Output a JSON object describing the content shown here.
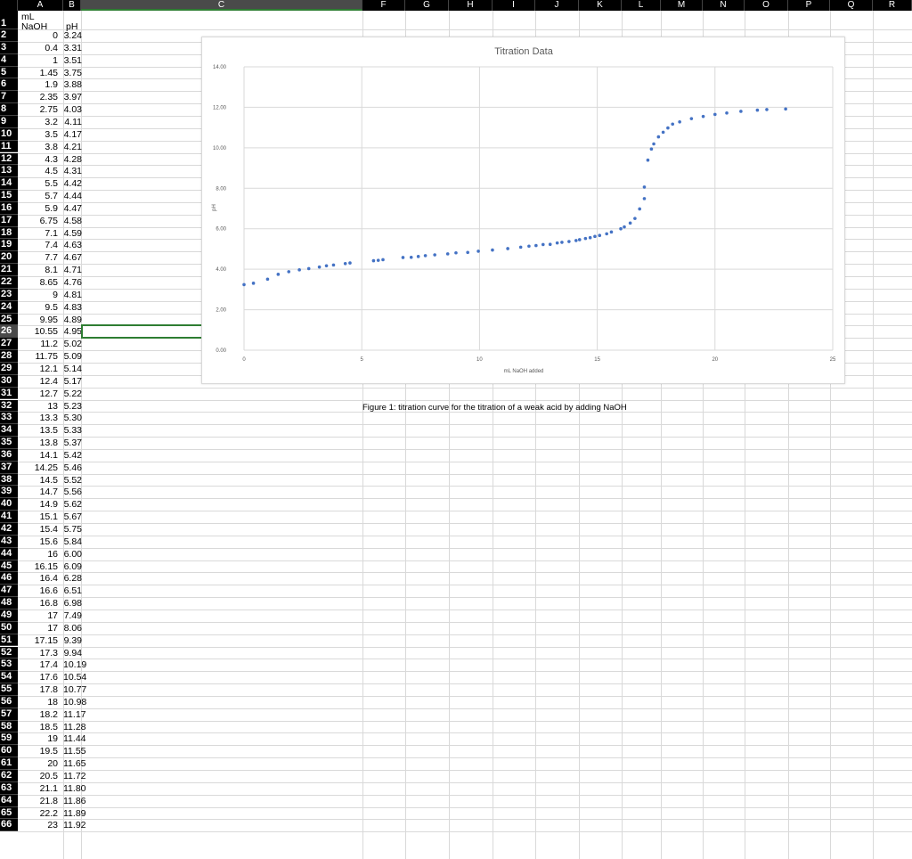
{
  "columns": [
    "A",
    "B",
    "C",
    "F",
    "G",
    "H",
    "I",
    "J",
    "K",
    "L",
    "M",
    "N",
    "O",
    "P",
    "Q",
    "R"
  ],
  "selected_column": "C",
  "header_row": {
    "a1": "mL",
    "a2": "NaOH",
    "b": "pH"
  },
  "rows": [
    [
      "0",
      "3.24"
    ],
    [
      "0.4",
      "3.31"
    ],
    [
      "1",
      "3.51"
    ],
    [
      "1.45",
      "3.75"
    ],
    [
      "1.9",
      "3.88"
    ],
    [
      "2.35",
      "3.97"
    ],
    [
      "2.75",
      "4.03"
    ],
    [
      "3.2",
      "4.11"
    ],
    [
      "3.5",
      "4.17"
    ],
    [
      "3.8",
      "4.21"
    ],
    [
      "4.3",
      "4.28"
    ],
    [
      "4.5",
      "4.31"
    ],
    [
      "5.5",
      "4.42"
    ],
    [
      "5.7",
      "4.44"
    ],
    [
      "5.9",
      "4.47"
    ],
    [
      "6.75",
      "4.58"
    ],
    [
      "7.1",
      "4.59"
    ],
    [
      "7.4",
      "4.63"
    ],
    [
      "7.7",
      "4.67"
    ],
    [
      "8.1",
      "4.71"
    ],
    [
      "8.65",
      "4.76"
    ],
    [
      "9",
      "4.81"
    ],
    [
      "9.5",
      "4.83"
    ],
    [
      "9.95",
      "4.89"
    ],
    [
      "10.55",
      "4.95"
    ],
    [
      "11.2",
      "5.02"
    ],
    [
      "11.75",
      "5.09"
    ],
    [
      "12.1",
      "5.14"
    ],
    [
      "12.4",
      "5.17"
    ],
    [
      "12.7",
      "5.22"
    ],
    [
      "13",
      "5.23"
    ],
    [
      "13.3",
      "5.30"
    ],
    [
      "13.5",
      "5.33"
    ],
    [
      "13.8",
      "5.37"
    ],
    [
      "14.1",
      "5.42"
    ],
    [
      "14.25",
      "5.46"
    ],
    [
      "14.5",
      "5.52"
    ],
    [
      "14.7",
      "5.56"
    ],
    [
      "14.9",
      "5.62"
    ],
    [
      "15.1",
      "5.67"
    ],
    [
      "15.4",
      "5.75"
    ],
    [
      "15.6",
      "5.84"
    ],
    [
      "16",
      "6.00"
    ],
    [
      "16.15",
      "6.09"
    ],
    [
      "16.4",
      "6.28"
    ],
    [
      "16.6",
      "6.51"
    ],
    [
      "16.8",
      "6.98"
    ],
    [
      "17",
      "7.49"
    ],
    [
      "17",
      "8.06"
    ],
    [
      "17.15",
      "9.39"
    ],
    [
      "17.3",
      "9.94"
    ],
    [
      "17.4",
      "10.19"
    ],
    [
      "17.6",
      "10.54"
    ],
    [
      "17.8",
      "10.77"
    ],
    [
      "18",
      "10.98"
    ],
    [
      "18.2",
      "11.17"
    ],
    [
      "18.5",
      "11.28"
    ],
    [
      "19",
      "11.44"
    ],
    [
      "19.5",
      "11.55"
    ],
    [
      "20",
      "11.65"
    ],
    [
      "20.5",
      "11.72"
    ],
    [
      "21.1",
      "11.80"
    ],
    [
      "21.8",
      "11.86"
    ],
    [
      "22.2",
      "11.89"
    ],
    [
      "23",
      "11.92"
    ]
  ],
  "active_row": "26",
  "chart_data": {
    "type": "scatter",
    "title": "Titration Data",
    "xlabel": "mL NaOH added",
    "ylabel": "pH",
    "xlim": [
      0,
      25
    ],
    "ylim": [
      0,
      14
    ],
    "x_ticks": [
      "0",
      "5",
      "10",
      "15",
      "20",
      "25"
    ],
    "y_ticks": [
      "0.00",
      "2.00",
      "4.00",
      "6.00",
      "8.00",
      "10.00",
      "12.00",
      "14.00"
    ],
    "grid": true,
    "marker_color": "#4472c4",
    "x": [
      0,
      0.4,
      1,
      1.45,
      1.9,
      2.35,
      2.75,
      3.2,
      3.5,
      3.8,
      4.3,
      4.5,
      5.5,
      5.7,
      5.9,
      6.75,
      7.1,
      7.4,
      7.7,
      8.1,
      8.65,
      9,
      9.5,
      9.95,
      10.55,
      11.2,
      11.75,
      12.1,
      12.4,
      12.7,
      13,
      13.3,
      13.5,
      13.8,
      14.1,
      14.25,
      14.5,
      14.7,
      14.9,
      15.1,
      15.4,
      15.6,
      16,
      16.15,
      16.4,
      16.6,
      16.8,
      17,
      17,
      17.15,
      17.3,
      17.4,
      17.6,
      17.8,
      18,
      18.2,
      18.5,
      19,
      19.5,
      20,
      20.5,
      21.1,
      21.8,
      22.2,
      23
    ],
    "y": [
      3.24,
      3.31,
      3.51,
      3.75,
      3.88,
      3.97,
      4.03,
      4.11,
      4.17,
      4.21,
      4.28,
      4.31,
      4.42,
      4.44,
      4.47,
      4.58,
      4.59,
      4.63,
      4.67,
      4.71,
      4.76,
      4.81,
      4.83,
      4.89,
      4.95,
      5.02,
      5.09,
      5.14,
      5.17,
      5.22,
      5.23,
      5.3,
      5.33,
      5.37,
      5.42,
      5.46,
      5.52,
      5.56,
      5.62,
      5.67,
      5.75,
      5.84,
      6.0,
      6.09,
      6.28,
      6.51,
      6.98,
      7.49,
      8.06,
      9.39,
      9.94,
      10.19,
      10.54,
      10.77,
      10.98,
      11.17,
      11.28,
      11.44,
      11.55,
      11.65,
      11.72,
      11.8,
      11.86,
      11.89,
      11.92
    ]
  },
  "caption": "Figure 1: titration curve for the titration of a weak acid by adding NaOH"
}
